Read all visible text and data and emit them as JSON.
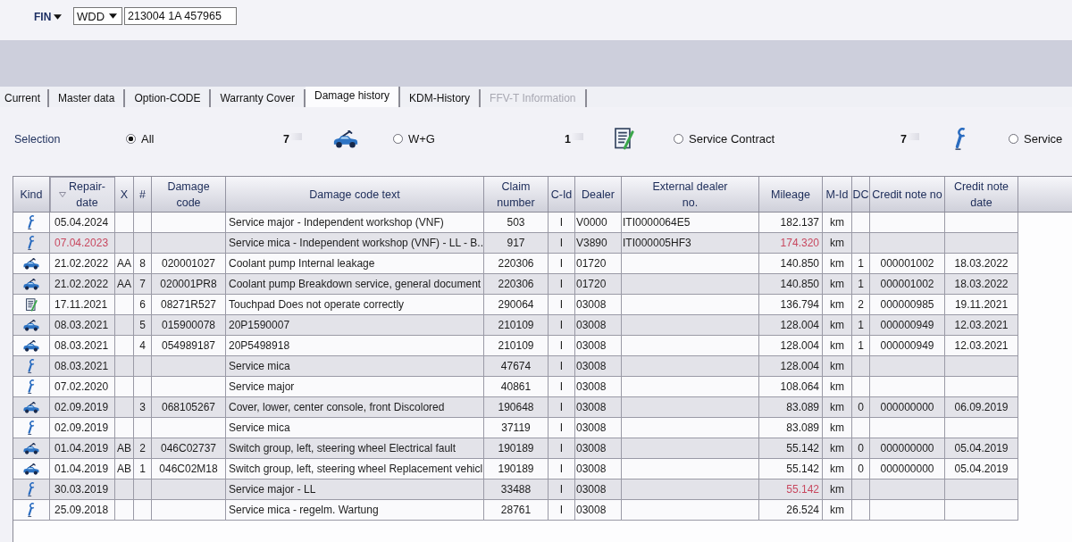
{
  "vehicle_lookup": {
    "label": "FIN",
    "prefix": "WDD",
    "value": "213004 1A 457965"
  },
  "tabs": [
    {
      "label": "Current",
      "selected": false,
      "disabled": false
    },
    {
      "label": "Master data",
      "selected": false,
      "disabled": false
    },
    {
      "label": "Option-CODE",
      "selected": false,
      "disabled": false
    },
    {
      "label": "Warranty Cover",
      "selected": false,
      "disabled": false
    },
    {
      "label": "Damage history",
      "selected": true,
      "disabled": false
    },
    {
      "label": "KDM-History",
      "selected": false,
      "disabled": false
    },
    {
      "label": "FFV-T Information",
      "selected": false,
      "disabled": true
    }
  ],
  "selection": {
    "label": "Selection",
    "options": [
      {
        "label": "All",
        "kind": "all",
        "selected": true
      },
      {
        "label": "W+G",
        "kind": "damage",
        "count": "7",
        "selected": false
      },
      {
        "label": "Service Contract",
        "kind": "contract",
        "count": "1",
        "selected": false
      },
      {
        "label": "Service",
        "kind": "service",
        "count": "7",
        "selected": false
      }
    ]
  },
  "table": {
    "columns": [
      {
        "label": "Kind",
        "sorted": false
      },
      {
        "label": "Repair-\ndate",
        "sorted": true
      },
      {
        "label": "X",
        "sorted": false
      },
      {
        "label": "#",
        "sorted": false
      },
      {
        "label": "Damage\ncode",
        "sorted": false
      },
      {
        "label": "Damage code text",
        "sorted": false
      },
      {
        "label": "Claim\nnumber",
        "sorted": false
      },
      {
        "label": "C-Id",
        "sorted": false
      },
      {
        "label": "Dealer",
        "sorted": false
      },
      {
        "label": "External dealer\nno.",
        "sorted": false
      },
      {
        "label": "Mileage",
        "sorted": false
      },
      {
        "label": "M-Id",
        "sorted": false
      },
      {
        "label": "DC",
        "sorted": false
      },
      {
        "label": "Credit note no",
        "sorted": false
      },
      {
        "label": "Credit note\ndate",
        "sorted": false
      }
    ],
    "rows": [
      {
        "kind": "service",
        "repair_date": "05.04.2024",
        "date_flagged": false,
        "damage_code_text": "Service major - Independent workshop (VNF)",
        "claim_number": "503",
        "c_id": "I",
        "dealer": "V0000",
        "external_dealer_no": "ITI0000064E5",
        "mileage": "182.137",
        "mileage_flagged": false,
        "m_id": "km"
      },
      {
        "kind": "service",
        "repair_date": "07.04.2023",
        "date_flagged": true,
        "damage_code_text": "Service mica - Independent workshop (VNF) - LL - B..",
        "claim_number": "917",
        "c_id": "I",
        "dealer": "V3890",
        "external_dealer_no": "ITI000005HF3",
        "mileage": "174.320",
        "mileage_flagged": true,
        "m_id": "km"
      },
      {
        "kind": "damage",
        "repair_date": "21.02.2022",
        "date_flagged": false,
        "x": "AA",
        "number": "8",
        "damage_code": "020001027",
        "damage_code_text": "Coolant pump Internal leakage",
        "claim_number": "220306",
        "c_id": "I",
        "dealer": "01720",
        "mileage": "140.850",
        "mileage_flagged": false,
        "m_id": "km",
        "dc": "1",
        "credit_note_no": "000001002",
        "credit_note_date": "18.03.2022"
      },
      {
        "kind": "damage",
        "repair_date": "21.02.2022",
        "date_flagged": false,
        "x": "AA",
        "number": "7",
        "damage_code": "020001PR8",
        "damage_code_text": "Coolant pump Breakdown service, general document",
        "claim_number": "220306",
        "c_id": "I",
        "dealer": "01720",
        "mileage": "140.850",
        "mileage_flagged": false,
        "m_id": "km",
        "dc": "1",
        "credit_note_no": "000001002",
        "credit_note_date": "18.03.2022"
      },
      {
        "kind": "contract",
        "repair_date": "17.11.2021",
        "date_flagged": false,
        "number": "6",
        "damage_code": "08271R527",
        "damage_code_text": "Touchpad Does not operate correctly",
        "claim_number": "290064",
        "c_id": "I",
        "dealer": "03008",
        "mileage": "136.794",
        "mileage_flagged": false,
        "m_id": "km",
        "dc": "2",
        "credit_note_no": "000000985",
        "credit_note_date": "19.11.2021"
      },
      {
        "kind": "damage",
        "repair_date": "08.03.2021",
        "date_flagged": false,
        "number": "5",
        "damage_code": "015900078",
        "damage_code_text": "20P1590007",
        "claim_number": "210109",
        "c_id": "I",
        "dealer": "03008",
        "mileage": "128.004",
        "mileage_flagged": false,
        "m_id": "km",
        "dc": "1",
        "credit_note_no": "000000949",
        "credit_note_date": "12.03.2021"
      },
      {
        "kind": "damage",
        "repair_date": "08.03.2021",
        "date_flagged": false,
        "number": "4",
        "damage_code": "054989187",
        "damage_code_text": "20P5498918",
        "claim_number": "210109",
        "c_id": "I",
        "dealer": "03008",
        "mileage": "128.004",
        "mileage_flagged": false,
        "m_id": "km",
        "dc": "1",
        "credit_note_no": "000000949",
        "credit_note_date": "12.03.2021"
      },
      {
        "kind": "service",
        "repair_date": "08.03.2021",
        "date_flagged": false,
        "damage_code_text": "Service mica",
        "claim_number": "47674",
        "c_id": "I",
        "dealer": "03008",
        "mileage": "128.004",
        "mileage_flagged": false,
        "m_id": "km"
      },
      {
        "kind": "service",
        "repair_date": "07.02.2020",
        "date_flagged": false,
        "damage_code_text": "Service major",
        "claim_number": "40861",
        "c_id": "I",
        "dealer": "03008",
        "mileage": "108.064",
        "mileage_flagged": false,
        "m_id": "km"
      },
      {
        "kind": "damage",
        "repair_date": "02.09.2019",
        "date_flagged": false,
        "number": "3",
        "damage_code": "068105267",
        "damage_code_text": "Cover, lower, center console, front Discolored",
        "claim_number": "190648",
        "c_id": "I",
        "dealer": "03008",
        "mileage": "83.089",
        "mileage_flagged": false,
        "m_id": "km",
        "dc": "0",
        "credit_note_no": "000000000",
        "credit_note_date": "06.09.2019"
      },
      {
        "kind": "service",
        "repair_date": "02.09.2019",
        "date_flagged": false,
        "damage_code_text": "Service mica",
        "claim_number": "37119",
        "c_id": "I",
        "dealer": "03008",
        "mileage": "83.089",
        "mileage_flagged": false,
        "m_id": "km"
      },
      {
        "kind": "damage",
        "repair_date": "01.04.2019",
        "date_flagged": false,
        "x": "AB",
        "number": "2",
        "damage_code": "046C02737",
        "damage_code_text": "Switch group, left, steering wheel Electrical fault",
        "claim_number": "190189",
        "c_id": "I",
        "dealer": "03008",
        "mileage": "55.142",
        "mileage_flagged": false,
        "m_id": "km",
        "dc": "0",
        "credit_note_no": "000000000",
        "credit_note_date": "05.04.2019"
      },
      {
        "kind": "damage",
        "repair_date": "01.04.2019",
        "date_flagged": false,
        "x": "AB",
        "number": "1",
        "damage_code": "046C02M18",
        "damage_code_text": "Switch group, left, steering wheel Replacement vehicl",
        "claim_number": "190189",
        "c_id": "I",
        "dealer": "03008",
        "mileage": "55.142",
        "mileage_flagged": false,
        "m_id": "km",
        "dc": "0",
        "credit_note_no": "000000000",
        "credit_note_date": "05.04.2019"
      },
      {
        "kind": "service",
        "repair_date": "30.03.2019",
        "date_flagged": false,
        "damage_code_text": "Service major - LL",
        "claim_number": "33488",
        "c_id": "I",
        "dealer": "03008",
        "mileage": "55.142",
        "mileage_flagged": true,
        "m_id": "km"
      },
      {
        "kind": "service",
        "repair_date": "25.09.2018",
        "date_flagged": false,
        "damage_code_text": "Service mica - regelm. Wartung",
        "claim_number": "28761",
        "c_id": "I",
        "dealer": "03008",
        "mileage": "26.524",
        "mileage_flagged": false,
        "m_id": "km"
      }
    ]
  }
}
